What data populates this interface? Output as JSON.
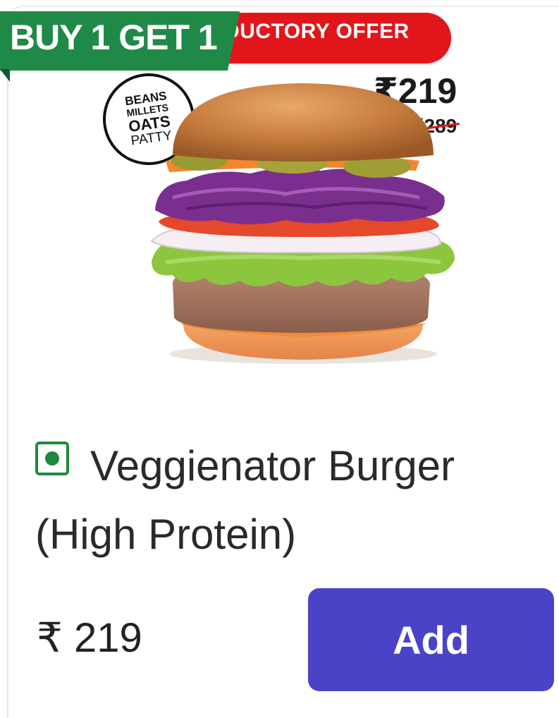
{
  "badges": {
    "promo": "BUY 1 GET 1",
    "offer_ribbon": "DUCTORY OFFER",
    "patty": [
      "BEANS",
      "MILLETS",
      "OATS",
      "PATTY"
    ]
  },
  "image_prices": {
    "offer": "₹219",
    "original": "₹289"
  },
  "product": {
    "veg_indicator": "veg-mark-icon",
    "name": "Veggienator Burger (High Protein)",
    "price": "₹ 219",
    "add_label": "Add"
  },
  "colors": {
    "promo_green": "#1f8a48",
    "offer_red": "#e2151b",
    "veg_green": "#1d8a3b",
    "add_button": "#4a43c8",
    "strike_red": "#d81a1a"
  }
}
